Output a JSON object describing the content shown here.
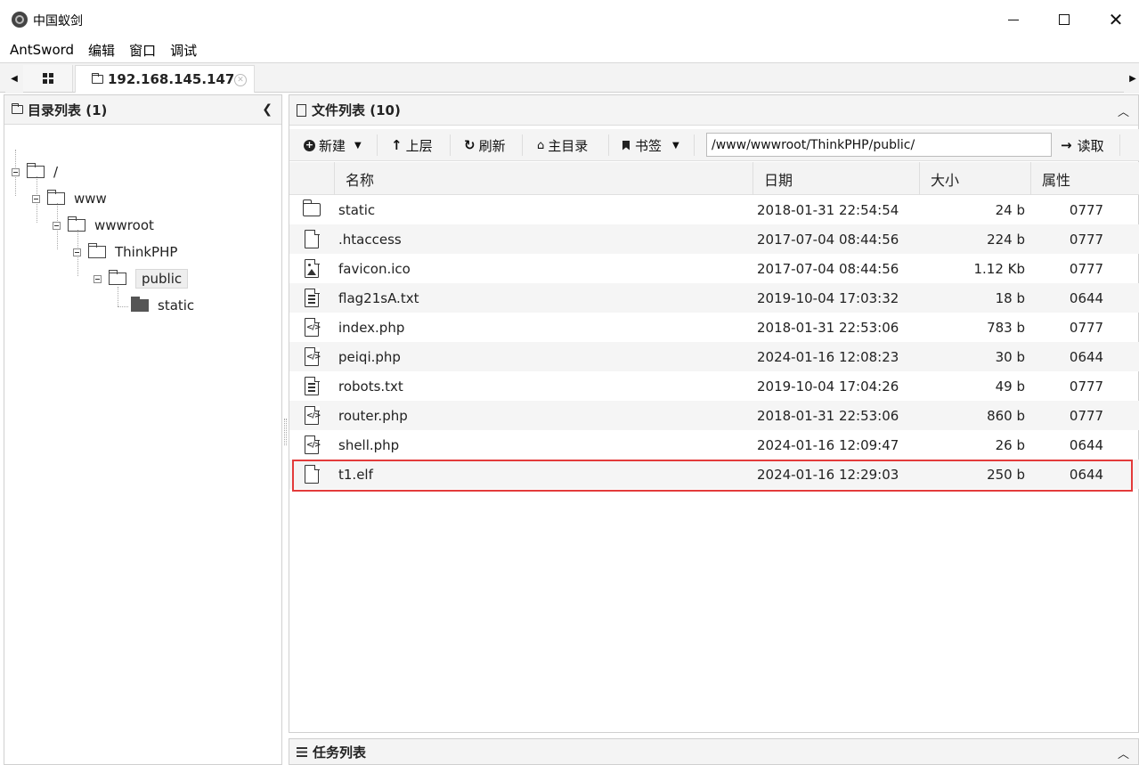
{
  "window": {
    "title": "中国蚁剑"
  },
  "menu": [
    "AntSword",
    "编辑",
    "窗口",
    "调试"
  ],
  "tabs": {
    "host": "192.168.145.147"
  },
  "left_panel": {
    "title": "目录列表 (1)"
  },
  "tree": [
    {
      "label": "/"
    },
    {
      "label": "www"
    },
    {
      "label": "wwwroot"
    },
    {
      "label": "ThinkPHP"
    },
    {
      "label": "public"
    },
    {
      "label": "static"
    }
  ],
  "right_panel": {
    "title": "文件列表 (10)",
    "toolbar": {
      "new": "新建",
      "up": "上层",
      "refresh": "刷新",
      "home": "主目录",
      "bookmark": "书签",
      "path": "/www/wwwroot/ThinkPHP/public/",
      "read": "读取"
    },
    "columns": {
      "name": "名称",
      "date": "日期",
      "size": "大小",
      "attr": "属性"
    },
    "files": [
      {
        "icon": "folder-icon",
        "name": "static",
        "date": "2018-01-31 22:54:54",
        "size": "24 b",
        "attr": "0777"
      },
      {
        "icon": "file-icon",
        "name": ".htaccess",
        "date": "2017-07-04 08:44:56",
        "size": "224 b",
        "attr": "0777"
      },
      {
        "icon": "image-file-icon",
        "name": "favicon.ico",
        "date": "2017-07-04 08:44:56",
        "size": "1.12 Kb",
        "attr": "0777"
      },
      {
        "icon": "text-file-icon",
        "name": "flag21sA.txt",
        "date": "2019-10-04 17:03:32",
        "size": "18 b",
        "attr": "0644"
      },
      {
        "icon": "code-file-icon",
        "name": "index.php",
        "date": "2018-01-31 22:53:06",
        "size": "783 b",
        "attr": "0777"
      },
      {
        "icon": "code-file-icon",
        "name": "peiqi.php",
        "date": "2024-01-16 12:08:23",
        "size": "30 b",
        "attr": "0644"
      },
      {
        "icon": "text-file-icon",
        "name": "robots.txt",
        "date": "2019-10-04 17:04:26",
        "size": "49 b",
        "attr": "0777"
      },
      {
        "icon": "code-file-icon",
        "name": "router.php",
        "date": "2018-01-31 22:53:06",
        "size": "860 b",
        "attr": "0777"
      },
      {
        "icon": "code-file-icon",
        "name": "shell.php",
        "date": "2024-01-16 12:09:47",
        "size": "26 b",
        "attr": "0644"
      },
      {
        "icon": "file-icon",
        "name": "t1.elf",
        "date": "2024-01-16 12:29:03",
        "size": "250 b",
        "attr": "0644"
      }
    ]
  },
  "task_panel": {
    "title": "任务列表"
  },
  "colors": {
    "highlight": "#e33b3b"
  }
}
